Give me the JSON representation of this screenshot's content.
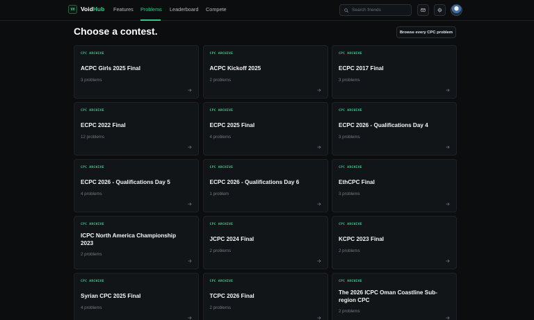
{
  "nav": {
    "logo_mark": "VH",
    "brand_main": "Void",
    "brand_accent": "Hub",
    "links": [
      "Features",
      "Problems",
      "Leaderboard",
      "Compete"
    ],
    "active_link": "Problems",
    "search_placeholder": "Search friends",
    "icons": [
      "search-icon",
      "mail-icon",
      "settings-icon"
    ]
  },
  "main": {
    "title": "Choose a contest.",
    "browse_label": "Browse every CPC problem",
    "cards": [
      {
        "tag": "CPC ARCHIVE",
        "title": "ACPC Girls 2025 Final",
        "count": "3 problems"
      },
      {
        "tag": "CPC ARCHIVE",
        "title": "ACPC Kickoff 2025",
        "count": "2 problems"
      },
      {
        "tag": "CPC ARCHIVE",
        "title": "ECPC 2017 Final",
        "count": "3 problems"
      },
      {
        "tag": "CPC ARCHIVE",
        "title": "ECPC 2022 Final",
        "count": "12 problems"
      },
      {
        "tag": "CPC ARCHIVE",
        "title": "ECPC 2025 Final",
        "count": "4 problems"
      },
      {
        "tag": "CPC ARCHIVE",
        "title": "ECPC 2026 - Qualifications Day 4",
        "count": "3 problems"
      },
      {
        "tag": "CPC ARCHIVE",
        "title": "ECPC 2026 - Qualifications Day 5",
        "count": "4 problems"
      },
      {
        "tag": "CPC ARCHIVE",
        "title": "ECPC 2026 - Qualifications Day 6",
        "count": "1 problem"
      },
      {
        "tag": "CPC ARCHIVE",
        "title": "EthCPC Final",
        "count": "3 problems"
      },
      {
        "tag": "CPC ARCHIVE",
        "title": "ICPC North America Championship 2023",
        "count": "2 problems"
      },
      {
        "tag": "CPC ARCHIVE",
        "title": "JCPC 2024 Final",
        "count": "2 problems"
      },
      {
        "tag": "CPC ARCHIVE",
        "title": "KCPC 2023 Final",
        "count": "2 problems"
      },
      {
        "tag": "CPC ARCHIVE",
        "title": "Syrian CPC 2025 Final",
        "count": "4 problems"
      },
      {
        "tag": "CPC ARCHIVE",
        "title": "TCPC 2026 Final",
        "count": "2 problems"
      },
      {
        "tag": "CPC ARCHIVE",
        "title": "The 2026 ICPC Oman Coastline Sub-region CPC",
        "count": "2 problems"
      }
    ]
  },
  "colors": {
    "background": "#0b0d0f",
    "card": "#121518",
    "accent": "#35c98a",
    "muted": "#737a81"
  }
}
